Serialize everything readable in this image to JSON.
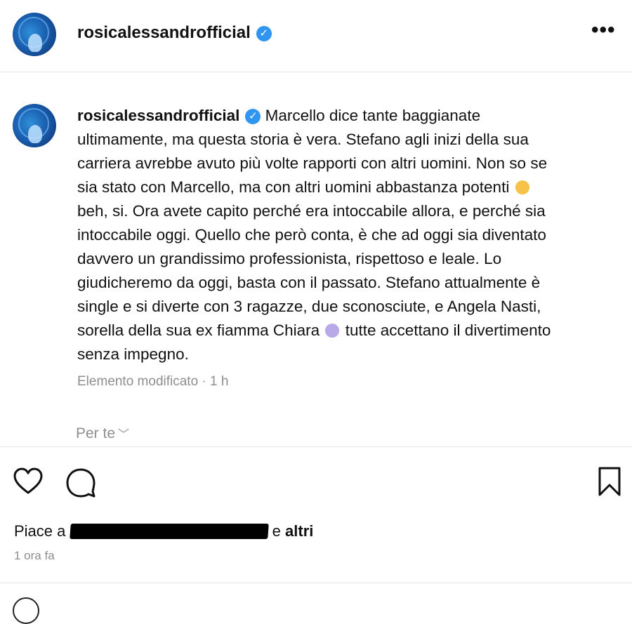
{
  "post": {
    "username": "rosicalessandrofficial",
    "more_icon": "more-options-icon",
    "verified_icon": "verified-badge-icon",
    "caption": {
      "lines": [
        "Marcello dice tante baggianate",
        "ultimamente, ma questa storia è vera. Stefano agli inizi della sua",
        "carriera avrebbe avuto più volte rapporti con altri uomini. Non so se",
        "sia stato con Marcello, ma con altri uomini abbastanza potenti",
        "beh, si. Ora avete capito perché era intoccabile allora, e perché sia",
        "intoccabile oggi. Quello che però conta, è che ad oggi sia diventato",
        "davvero un grandissimo professionista, rispettoso e leale. Lo",
        "giudicheremo da oggi, basta con il passato. Stefano attualmente è",
        "single e si diverte con 3 ragazze, due sconosciute, e Angela Nasti,",
        "sorella della sua ex fiamma Chiara",
        "tutte accettano il divertimento",
        "senza impegno."
      ],
      "emoji_1": "heart-hands-emoji",
      "emoji_2": "shocked-face-emoji"
    },
    "edited_meta": "Elemento modificato · 1 h",
    "for_you_label": "Per te",
    "likes": {
      "prefix": "Piace a",
      "suffix_e": "e",
      "suffix_altri": "altri"
    },
    "timestamp": "1 ora fa"
  },
  "icons": {
    "like": "heart-outline-icon",
    "comment": "comment-bubble-icon",
    "save": "bookmark-outline-icon"
  },
  "colors": {
    "verified": "#2f95f0",
    "muted_text": "#8e8e8e",
    "divider": "#e6e6e6"
  }
}
